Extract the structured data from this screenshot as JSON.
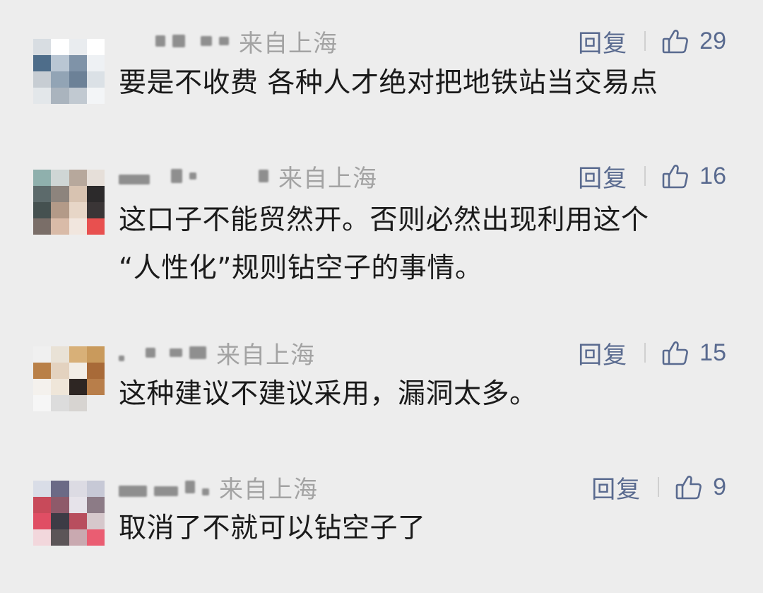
{
  "comments": [
    {
      "location": "来自上海",
      "reply_label": "回复",
      "likes": "29",
      "lines": [
        "要是不收费 各种人才绝对把地铁站当交易点"
      ],
      "avatar_colors": [
        "#d8dde2",
        "#ffffff",
        "#e9ecef",
        "#ffffff",
        "#4e6d8a",
        "#b9c6d3",
        "#7f93a8",
        "#eef1f4",
        "#c7cdd3",
        "#92a4b5",
        "#6c8197",
        "#dbe1e6",
        "#e3e7ea",
        "#aab4be",
        "#c1c9d1",
        "#f3f5f7"
      ]
    },
    {
      "location": "来自上海",
      "reply_label": "回复",
      "likes": "16",
      "lines": [
        "这口子不能贸然开。否则必然出现利用这个",
        "“人性化”规则钻空子的事情。"
      ],
      "avatar_colors": [
        "#8fb0ad",
        "#cfd6d5",
        "#b7a89c",
        "#e6dfd9",
        "#5c6a6b",
        "#8d847d",
        "#d8c3b1",
        "#2c2a2b",
        "#455150",
        "#b39a88",
        "#e7d6c7",
        "#3a3536",
        "#7a6e68",
        "#d9bba8",
        "#f1e6de",
        "#e8504f"
      ]
    },
    {
      "location": "来自上海",
      "reply_label": "回复",
      "likes": "15",
      "lines": [
        "这种建议不建议采用，漏洞太多。"
      ],
      "avatar_colors": [
        "#f0f0f0",
        "#e9e2d6",
        "#d8b078",
        "#c99a5c",
        "#b98048",
        "#e3d2bf",
        "#f2ede6",
        "#a86a38",
        "#f4f1ed",
        "#efe6d9",
        "#2e2623",
        "#b87e4a",
        "#f6f6f6",
        "#dcdcdc",
        "#d7d4d1",
        "#ededed"
      ]
    },
    {
      "location": "来自上海",
      "reply_label": "回复",
      "likes": "9",
      "lines": [
        "取消了不就可以钻空子了"
      ],
      "avatar_colors": [
        "#d9dde7",
        "#6b6a86",
        "#dcdbe3",
        "#c7c9d6",
        "#c84a5a",
        "#8e5a6a",
        "#e6e3ea",
        "#8c7b86",
        "#e04e64",
        "#3d3b45",
        "#b84e5e",
        "#d6c8cc",
        "#f2d7dc",
        "#5c5558",
        "#c9a9b0",
        "#ea5d72"
      ]
    }
  ]
}
